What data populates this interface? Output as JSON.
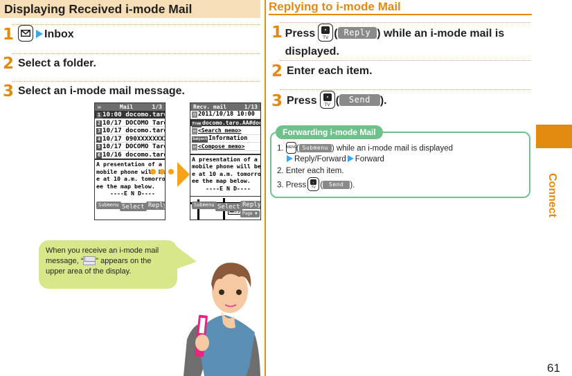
{
  "left": {
    "title": "Displaying Received i-mode Mail",
    "steps": [
      {
        "num": "1",
        "key_icon": "mail-key-icon",
        "text": "Inbox"
      },
      {
        "num": "2",
        "text": "Select a folder."
      },
      {
        "num": "3",
        "text": "Select an i-mode mail message."
      }
    ],
    "screen_list": {
      "title": "Mail",
      "page": "1/3",
      "rows": [
        {
          "index": "1",
          "date": "10:00",
          "sender": "docomo.taro."
        },
        {
          "index": "2",
          "date": "10/17",
          "sender": "DOCOMO Taro"
        },
        {
          "index": "3",
          "date": "10/17",
          "sender": "docomo.taro."
        },
        {
          "index": "4",
          "date": "10/17",
          "sender": "090XXXXXXXX"
        },
        {
          "index": "5",
          "date": "10/17",
          "sender": "DOCOMO Taro"
        },
        {
          "index": "6",
          "date": "10/16",
          "sender": "docomo.taro."
        }
      ],
      "preview": "A presentation of a new\nmobile phone will be mad\ne at 10 a.m. tomorrow. S\nee the map below.\n    ----E N D----",
      "softkeys": {
        "left": "Submenu",
        "center": "Select",
        "right": "Reply"
      }
    },
    "screen_detail": {
      "title": "Recv. mail",
      "page": "1/13",
      "date": "2011/10/18 10:00",
      "from_label": "From",
      "from": "docomo.taro.AA#docom",
      "search_memo": "<Search memo>",
      "subject_label": "Subject",
      "subject": "Information",
      "compose_memo": "<Compose memo>",
      "body": "A presentation of a new\nmobile phone will be mad\ne at 10 a.m. tomorrow. S\nee the map below.\n    ----E N D----",
      "map_label": "銀行",
      "softkeys": {
        "left": "Submenu",
        "center": "Select",
        "right": "Reply",
        "page": "Page ▼"
      }
    },
    "bubble_text_before": "When you receive an i-mode mail message, “",
    "bubble_text_after": "” appears on the upper area of the display."
  },
  "right": {
    "title": "Replying to i-mode Mail",
    "steps": [
      {
        "num": "1",
        "pre": "Press",
        "softkey": "Reply",
        "post": "while an i-mode mail is displayed."
      },
      {
        "num": "2",
        "text": "Enter each item."
      },
      {
        "num": "3",
        "pre": "Press",
        "softkey": "Send",
        "post": "."
      }
    ],
    "forwarding": {
      "title": "Forwarding i-mode Mail",
      "line1_num": "1.",
      "line1_key": "MENU",
      "line1_softkey": "Submenu",
      "line1_text": "while an i-mode mail is displayed",
      "line1b_a": "Reply/Forward",
      "line1b_b": "Forward",
      "line2": "2. Enter each item.",
      "line3_num": "3.",
      "line3_pre": "Press",
      "line3_softkey": "Send",
      "line3_post": "."
    }
  },
  "side_tab": {
    "label": "Connect",
    "color": "#e08a12"
  },
  "page_number": "61",
  "colors": {
    "accent": "#e08a12",
    "title_bg": "#f6dfb6",
    "arrow": "#3ea6e6",
    "green": "#6fc08a",
    "bubble": "#d8e78a"
  }
}
